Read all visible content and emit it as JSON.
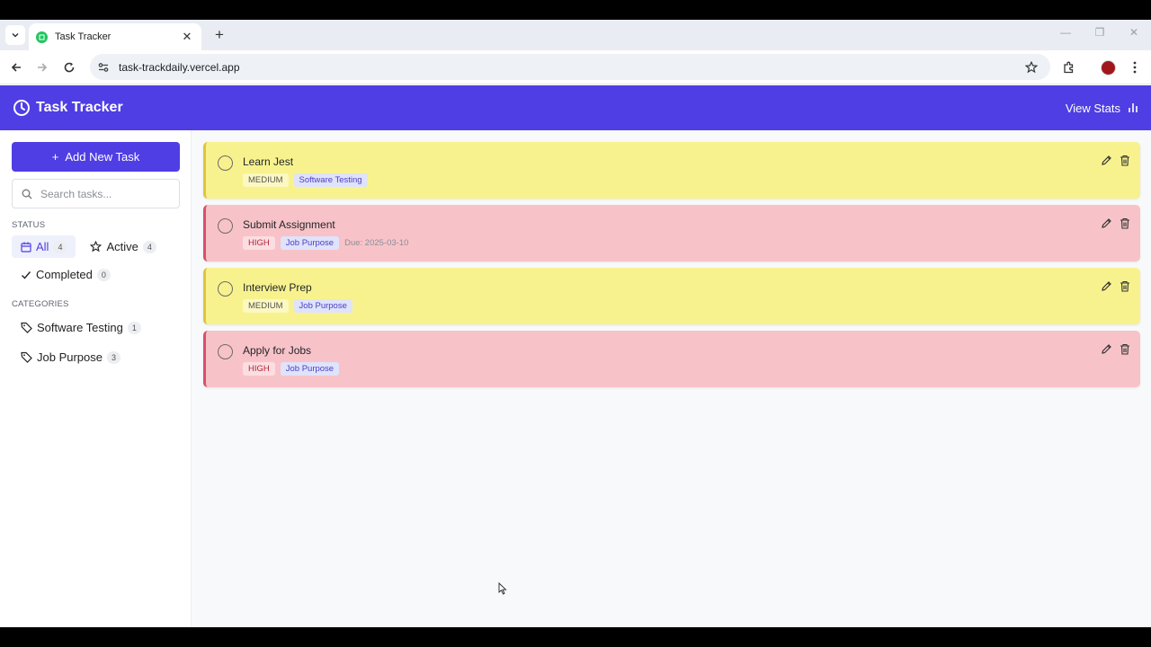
{
  "browser": {
    "tab_title": "Task Tracker",
    "url": "task-trackdaily.vercel.app"
  },
  "header": {
    "title": "Task Tracker",
    "view_stats": "View Stats"
  },
  "sidebar": {
    "add_button": "Add New Task",
    "search_placeholder": "Search tasks...",
    "status_label": "STATUS",
    "status_filters": [
      {
        "label": "All",
        "count": "4"
      },
      {
        "label": "Active",
        "count": "4"
      },
      {
        "label": "Completed",
        "count": "0"
      }
    ],
    "categories_label": "CATEGORIES",
    "categories": [
      {
        "label": "Software Testing",
        "count": "1"
      },
      {
        "label": "Job Purpose",
        "count": "3"
      }
    ]
  },
  "tasks": [
    {
      "title": "Learn Jest",
      "priority": "MEDIUM",
      "category": "Software Testing",
      "due": ""
    },
    {
      "title": "Submit Assignment",
      "priority": "HIGH",
      "category": "Job Purpose",
      "due": "Due: 2025-03-10"
    },
    {
      "title": "Interview Prep",
      "priority": "MEDIUM",
      "category": "Job Purpose",
      "due": ""
    },
    {
      "title": "Apply for Jobs",
      "priority": "HIGH",
      "category": "Job Purpose",
      "due": ""
    }
  ],
  "colors": {
    "accent": "#4f3ee4",
    "medium_bg": "#f8f28e",
    "high_bg": "#f8c3c8"
  }
}
